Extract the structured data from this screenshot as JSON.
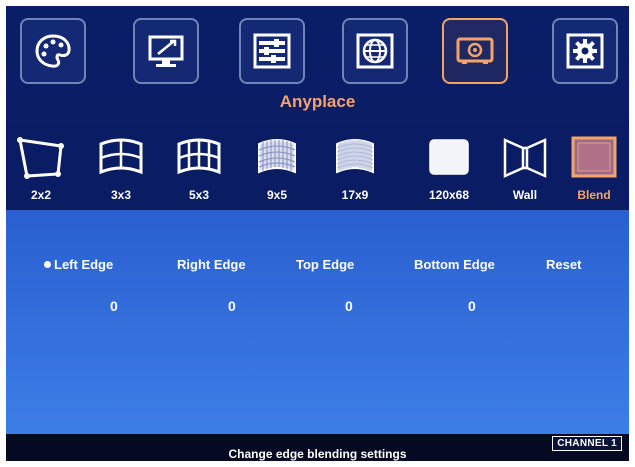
{
  "menu": {
    "tabs": [
      {
        "icon": "palette-icon",
        "active": false
      },
      {
        "icon": "monitor-edit-icon",
        "active": false
      },
      {
        "icon": "sliders-icon",
        "active": false
      },
      {
        "icon": "globe-icon",
        "active": false
      },
      {
        "icon": "projector-icon",
        "active": true
      },
      {
        "icon": "gear-icon",
        "active": false
      }
    ],
    "title": "Anyplace"
  },
  "modes": [
    {
      "label": "2x2",
      "icon": "grid-2x2-icon"
    },
    {
      "label": "3x3",
      "icon": "curve-3x3-icon"
    },
    {
      "label": "5x3",
      "icon": "curve-5x3-icon"
    },
    {
      "label": "9x5",
      "icon": "curve-9x5-icon"
    },
    {
      "label": "17x9",
      "icon": "curve-17x9-icon"
    },
    {
      "label": "120x68",
      "icon": "curve-120x68-icon"
    },
    {
      "label": "Wall",
      "icon": "wall-icon"
    },
    {
      "label": "Blend",
      "icon": "blend-icon",
      "active": true
    }
  ],
  "settings": [
    {
      "label": "Left Edge",
      "value": "0",
      "selected": true
    },
    {
      "label": "Right Edge",
      "value": "0"
    },
    {
      "label": "Top Edge",
      "value": "0"
    },
    {
      "label": "Bottom Edge",
      "value": "0"
    },
    {
      "label": "Reset"
    }
  ],
  "status": {
    "hint": "Change edge blending settings",
    "channel": "CHANNEL 1"
  },
  "colors": {
    "top_bg": "#0a1e68",
    "panel_bg": "#3570dc",
    "accent": "#f4a46a"
  }
}
